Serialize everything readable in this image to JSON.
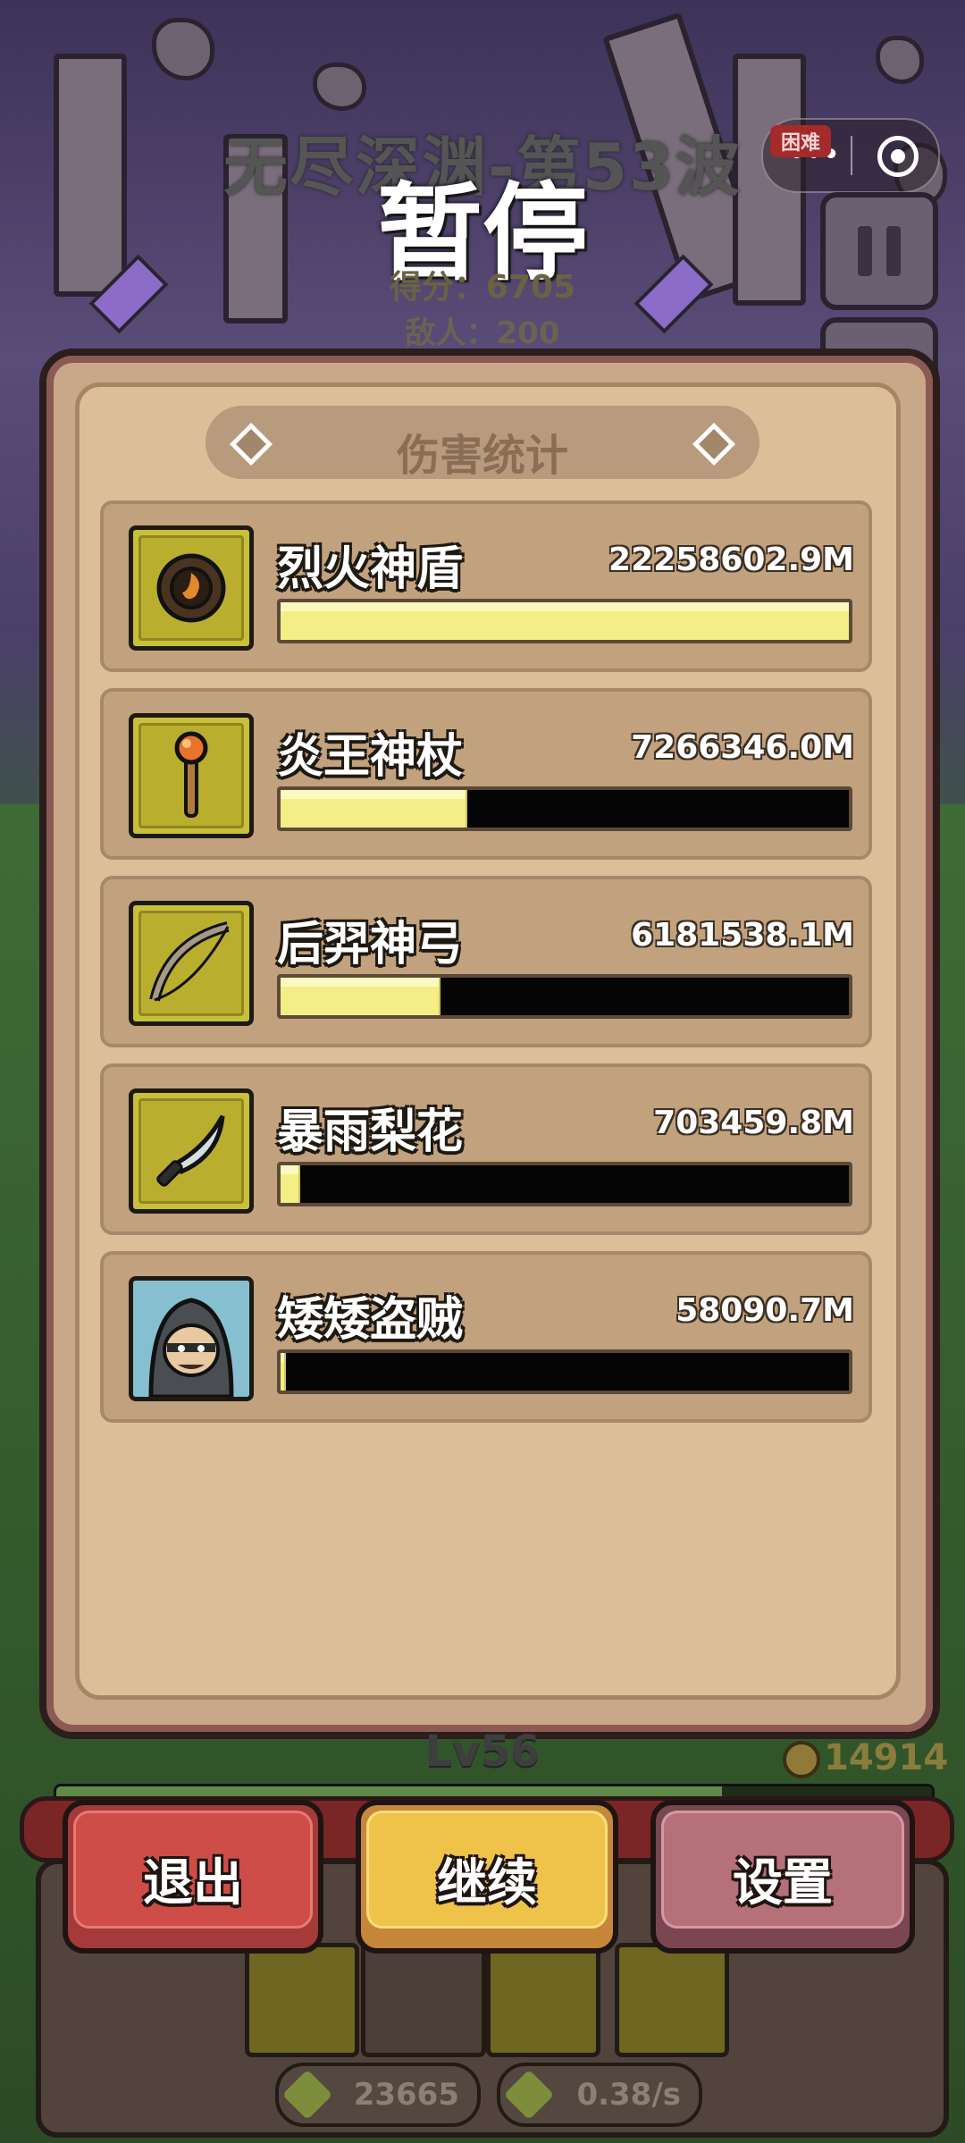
{
  "hud": {
    "wave_title": "无尽深渊-第53波",
    "pause_title": "暂停",
    "score": "得分：6705",
    "enemies": "敌人：200",
    "difficulty_badge": "困难",
    "capsule_menu": "•••"
  },
  "panel": {
    "title": "伤害统计",
    "rows": [
      {
        "name": "烈火神盾",
        "value": "22258602.9M",
        "fill": 1.0,
        "icon": "shield-icon"
      },
      {
        "name": "炎王神杖",
        "value": "7266346.0M",
        "fill": 0.326,
        "icon": "staff-icon"
      },
      {
        "name": "后羿神弓",
        "value": "6181538.1M",
        "fill": 0.278,
        "icon": "bow-icon"
      },
      {
        "name": "暴雨梨花",
        "value": "703459.8M",
        "fill": 0.032,
        "icon": "blade-icon"
      },
      {
        "name": "矮矮盗贼",
        "value": "58090.7M",
        "fill": 0.003,
        "icon": "thief-portrait-icon"
      }
    ]
  },
  "bottom": {
    "level": "Lv56",
    "coins": "14914",
    "xp_fill": 0.76,
    "stat_attack": "23665",
    "stat_speed": "0.38/s"
  },
  "buttons": {
    "exit": "退出",
    "continue": "继续",
    "settings": "设置"
  },
  "colors": {
    "bar_fill": "#f3ef86",
    "bar_track": "#050505",
    "panel_bg": "#dbbf98",
    "exit": "#cf4d48",
    "continue": "#efc24a",
    "settings": "#b6707a"
  }
}
